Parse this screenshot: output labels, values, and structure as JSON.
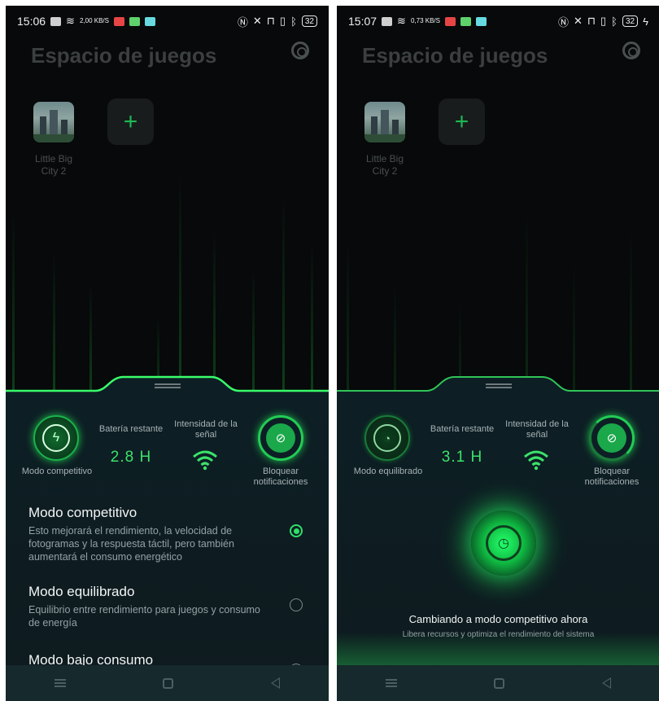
{
  "colors": {
    "accent": "#2ee06a",
    "panel": "#0d1f25",
    "background": "#07090a"
  },
  "left": {
    "status": {
      "time": "15:06",
      "speed": "2,00 KB/S",
      "battery": "32"
    },
    "title": "Espacio de juegos",
    "game": {
      "name": "Little Big City 2"
    },
    "add_label": "+",
    "panel": {
      "mode_label": "Modo competitivo",
      "mode_icon": "bolt-icon",
      "battery_label": "Batería restante",
      "battery_value": "2.8 H",
      "signal_label": "Intensidad de la señal",
      "notif_label": "Bloquear notificaciones",
      "options": [
        {
          "title": "Modo competitivo",
          "desc": "Esto mejorará el rendimiento, la velocidad de fotogramas y la respuesta táctil, pero también aumentará el consumo energético",
          "selected": true
        },
        {
          "title": "Modo equilibrado",
          "desc": "Equilibrio entre rendimiento para juegos y consumo de energía",
          "selected": false
        },
        {
          "title": "Modo bajo consumo",
          "desc": "",
          "selected": false
        }
      ]
    }
  },
  "right": {
    "status": {
      "time": "15:07",
      "speed": "0,73 KB/S",
      "battery": "32"
    },
    "title": "Espacio de juegos",
    "game": {
      "name": "Little Big City 2"
    },
    "add_label": "+",
    "panel": {
      "mode_label": "Modo equilibrado",
      "mode_icon": "gauge-icon",
      "battery_label": "Batería restante",
      "battery_value": "3.1 H",
      "signal_label": "Intensidad de la señal",
      "notif_label": "Bloquear notificaciones",
      "switch_title": "Cambiando a modo competitivo ahora",
      "switch_sub": "Libera recursos y optimiza el rendimiento del sistema"
    }
  }
}
